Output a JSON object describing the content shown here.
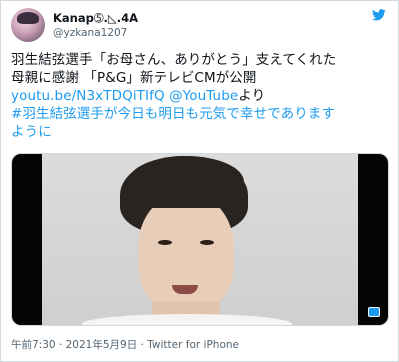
{
  "tweet": {
    "display_name": "Kanap➄.◺.4A",
    "handle": "@yzkana1207",
    "text_lines": [
      "羽生結弦選手「お母さん、ありがとう」支えてくれた",
      "母親に感謝 「P&G」新テレビCMが公開"
    ],
    "link_url": "youtu.be/N3xTDQiTIfQ",
    "link_handle": "@YouTube",
    "link_suffix": "より",
    "hashtag_line1": "#羽生結弦選手が今日も明日も元気で幸せであります",
    "hashtag_line2": "ように",
    "time": "午前7:30",
    "date": "2021年5月9日",
    "source": "Twitter for iPhone",
    "separator": "·"
  },
  "icons": {
    "logo": "twitter-bird-icon",
    "media": "video-badge-icon"
  },
  "colors": {
    "link": "#1d9bf0",
    "text": "#0f1419",
    "secondary": "#536471",
    "border": "#cfd9de"
  }
}
